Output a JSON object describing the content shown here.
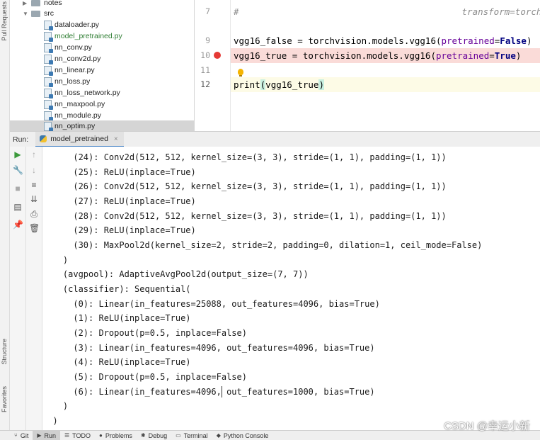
{
  "left_strip": {
    "top_tab": "Pull Requests",
    "structure_tab": "Structure",
    "favorites_tab": "Favorites"
  },
  "project_tree": {
    "items": [
      {
        "label": "notes",
        "type": "folder",
        "expanded": false
      },
      {
        "label": "src",
        "type": "folder",
        "expanded": true
      },
      {
        "label": "dataloader.py",
        "type": "file"
      },
      {
        "label": "model_pretrained.py",
        "type": "file",
        "modified": true
      },
      {
        "label": "nn_conv.py",
        "type": "file"
      },
      {
        "label": "nn_conv2d.py",
        "type": "file"
      },
      {
        "label": "nn_linear.py",
        "type": "file"
      },
      {
        "label": "nn_loss.py",
        "type": "file"
      },
      {
        "label": "nn_loss_network.py",
        "type": "file"
      },
      {
        "label": "nn_maxpool.py",
        "type": "file"
      },
      {
        "label": "nn_module.py",
        "type": "file"
      },
      {
        "label": "nn_optim.py",
        "type": "file",
        "selected": true
      }
    ]
  },
  "editor": {
    "line_numbers": [
      "7",
      "9",
      "10",
      "11",
      "12"
    ],
    "line7": {
      "hash": "#",
      "comment": "transform=torchv"
    },
    "line9": {
      "a": "vgg16_false = torchvision.models.vgg16(",
      "param": "pretrained",
      "eq": "=",
      "bool": "False",
      "close": ")"
    },
    "line10": {
      "a": "vgg16_true = torchvision.models.vgg16(",
      "param": "pretrained",
      "eq": "=",
      "bool": "True",
      "close": ")"
    },
    "line12": {
      "fn": "print",
      "open": "(",
      "arg": "vgg16_true",
      "close": ")"
    },
    "breakpoint_color": "#e53935"
  },
  "run": {
    "label": "Run:",
    "tab": "model_pretrained",
    "close": "×"
  },
  "console_lines": [
    "      (24): Conv2d(512, 512, kernel_size=(3, 3), stride=(1, 1), padding=(1, 1))",
    "      (25): ReLU(inplace=True)",
    "      (26): Conv2d(512, 512, kernel_size=(3, 3), stride=(1, 1), padding=(1, 1))",
    "      (27): ReLU(inplace=True)",
    "      (28): Conv2d(512, 512, kernel_size=(3, 3), stride=(1, 1), padding=(1, 1))",
    "      (29): ReLU(inplace=True)",
    "      (30): MaxPool2d(kernel_size=2, stride=2, padding=0, dilation=1, ceil_mode=False)",
    "    )",
    "    (avgpool): AdaptiveAvgPool2d(output_size=(7, 7))",
    "    (classifier): Sequential(",
    "      (0): Linear(in_features=25088, out_features=4096, bias=True)",
    "      (1): ReLU(inplace=True)",
    "      (2): Dropout(p=0.5, inplace=False)",
    "      (3): Linear(in_features=4096, out_features=4096, bias=True)",
    "      (4): ReLU(inplace=True)",
    "      (5): Dropout(p=0.5, inplace=False)",
    "      (6): Linear(in_features=4096, out_features=1000, bias=True)",
    "    )",
    "  )"
  ],
  "bottom_bar": {
    "git": "Git",
    "run": "Run",
    "todo": "TODO",
    "problems": "Problems",
    "debug": "Debug",
    "terminal": "Terminal",
    "python_console": "Python Console"
  },
  "watermark": "CSDN @幸运小新"
}
